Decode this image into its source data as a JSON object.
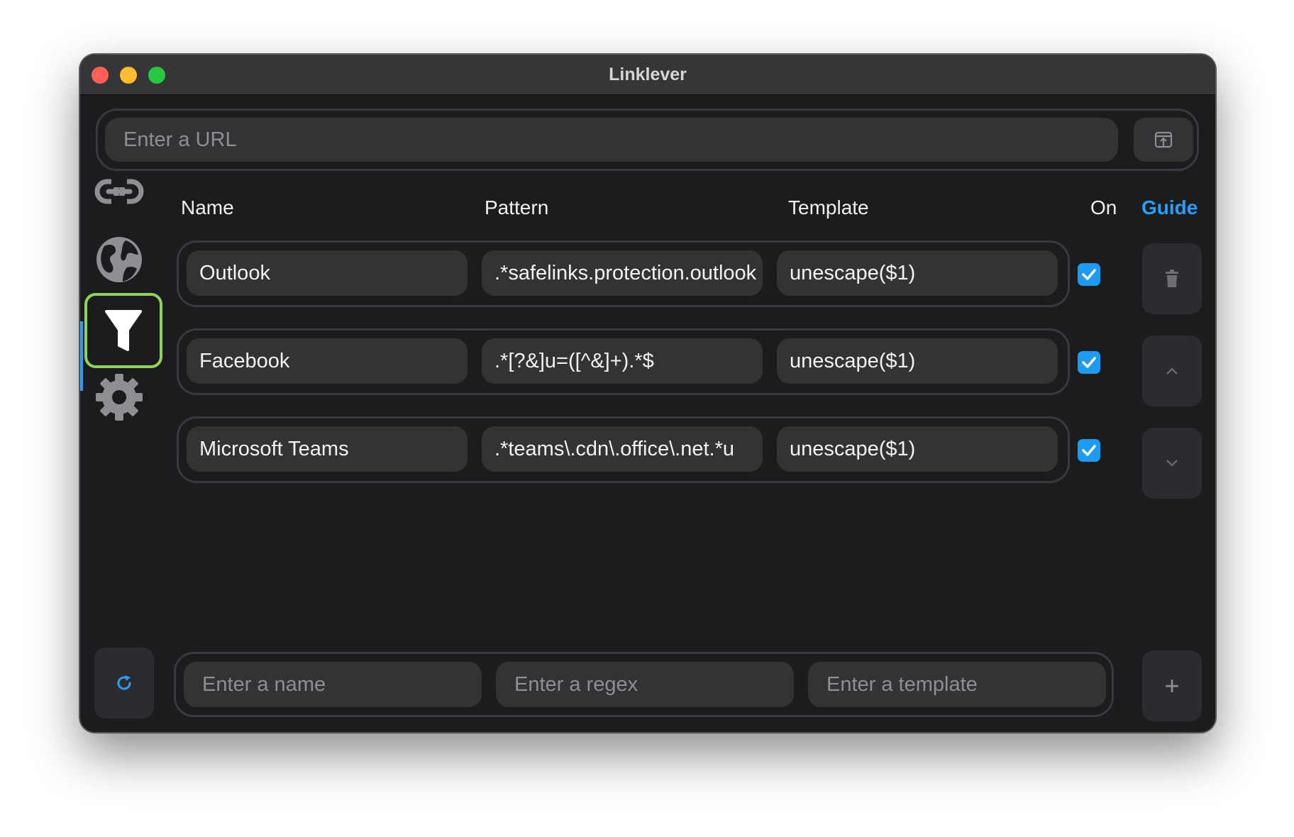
{
  "window": {
    "title": "Linklever"
  },
  "url_bar": {
    "placeholder": "Enter a URL",
    "value": ""
  },
  "sidebar": {
    "items": [
      {
        "name": "links",
        "icon": "link-icon",
        "active": false
      },
      {
        "name": "globe",
        "icon": "globe-icon",
        "active": false
      },
      {
        "name": "filters",
        "icon": "funnel-icon",
        "active": true
      },
      {
        "name": "settings",
        "icon": "gear-icon",
        "active": false
      }
    ]
  },
  "table": {
    "headers": {
      "name": "Name",
      "pattern": "Pattern",
      "template": "Template",
      "on": "On",
      "guide": "Guide"
    },
    "rows": [
      {
        "name": "Outlook",
        "pattern": ".*safelinks.protection.outlook",
        "template": "unescape($1)",
        "on": true
      },
      {
        "name": "Facebook",
        "pattern": ".*[?&]u=([^&]+).*$",
        "template": "unescape($1)",
        "on": true
      },
      {
        "name": "Microsoft Teams",
        "pattern": ".*teams\\.cdn\\.office\\.net.*u",
        "template": "unescape($1)",
        "on": true
      }
    ]
  },
  "new_rule": {
    "name_placeholder": "Enter a name",
    "regex_placeholder": "Enter a regex",
    "template_placeholder": "Enter a template",
    "add_label": "+"
  },
  "colors": {
    "accent": "#2a9df4",
    "active_outline": "#8fd45a",
    "background": "#1c1c1f",
    "field": "#333336"
  }
}
